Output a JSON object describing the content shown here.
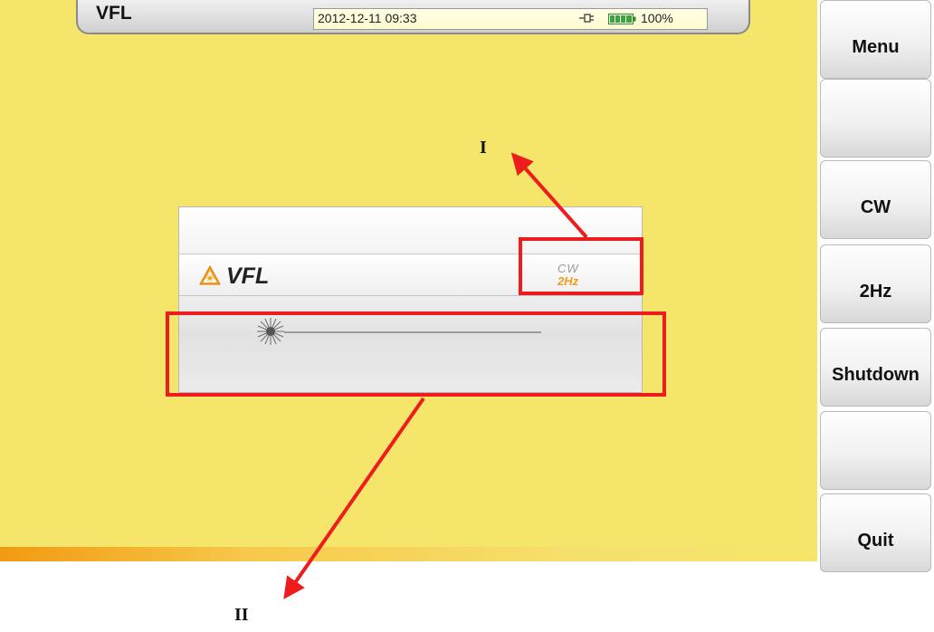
{
  "status_bar": {
    "title": "VFL",
    "datetime": "2012-12-11 09:33",
    "battery_percent": "100%",
    "icons": [
      "power-plug-icon",
      "battery-icon"
    ]
  },
  "vfl_panel": {
    "label": "VFL",
    "mode_cw": "CW",
    "mode_2hz": "2Hz",
    "icons": [
      "laser-warning-icon",
      "laser-burst-icon"
    ],
    "accent_color": "#f39a1c"
  },
  "side_buttons": [
    {
      "label": "Menu"
    },
    {
      "label": ""
    },
    {
      "label": "CW"
    },
    {
      "label": "2Hz"
    },
    {
      "label": "Shutdown"
    },
    {
      "label": ""
    },
    {
      "label": "Quit"
    }
  ],
  "annotations": {
    "label_1": "I",
    "label_2": "II",
    "color": "#ee1c1c"
  },
  "colors": {
    "screen_background": "#f6e56b"
  }
}
